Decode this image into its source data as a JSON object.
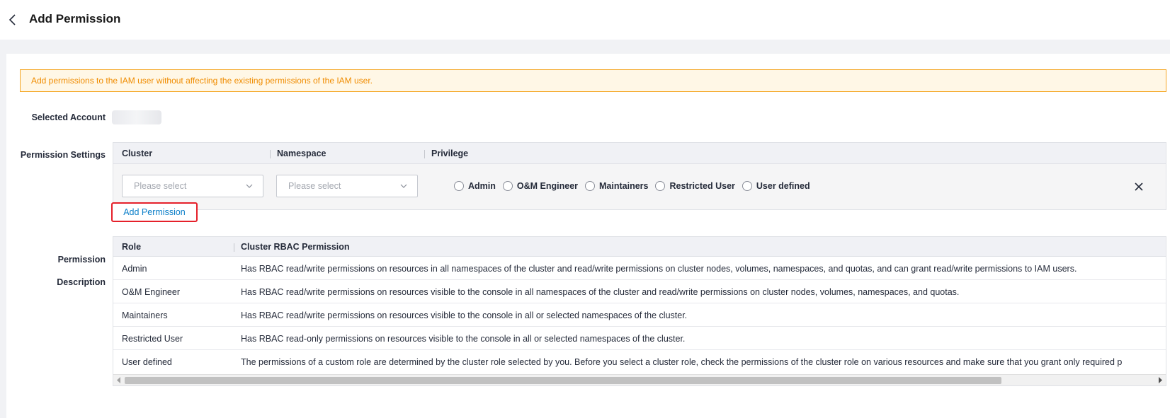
{
  "header": {
    "title": "Add Permission"
  },
  "notice": {
    "text": "Add permissions to the IAM user without affecting the existing permissions of the IAM user."
  },
  "selected_account": {
    "label": "Selected Account"
  },
  "permission_settings": {
    "label": "Permission Settings",
    "columns": [
      "Cluster",
      "Namespace",
      "Privilege"
    ],
    "cluster_select": {
      "placeholder": "Please select"
    },
    "namespace_select": {
      "placeholder": "Please select"
    },
    "privileges": [
      "Admin",
      "O&M Engineer",
      "Maintainers",
      "Restricted User",
      "User defined"
    ],
    "add_button_label": "Add Permission"
  },
  "permission_description": {
    "label_line1": "Permission",
    "label_line2": "Description",
    "columns": [
      "Role",
      "Cluster RBAC Permission"
    ],
    "rows": [
      {
        "role": "Admin",
        "permission": "Has RBAC read/write permissions on resources in all namespaces of the cluster and read/write permissions on cluster nodes, volumes, namespaces, and quotas, and can grant read/write permissions to IAM users."
      },
      {
        "role": "O&M Engineer",
        "permission": "Has RBAC read/write permissions on resources visible to the console in all namespaces of the cluster and read/write permissions on cluster nodes, volumes, namespaces, and quotas."
      },
      {
        "role": "Maintainers",
        "permission": "Has RBAC read/write permissions on resources visible to the console in all or selected namespaces of the cluster."
      },
      {
        "role": "Restricted User",
        "permission": "Has RBAC read-only permissions on resources visible to the console in all or selected namespaces of the cluster."
      },
      {
        "role": "User defined",
        "permission": "The permissions of a custom role are determined by the cluster role selected by you. Before you select a cluster role, check the permissions of the cluster role on various resources and make sure that you grant only required p"
      }
    ]
  },
  "colors": {
    "notice_border": "#f5a623",
    "notice_text": "#f08c00",
    "link": "#0a7ec8",
    "highlight": "#e5202a"
  }
}
